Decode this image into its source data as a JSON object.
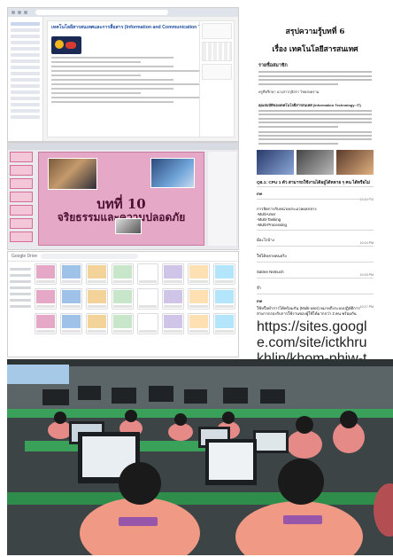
{
  "site": {
    "course_title": "เทคโนโลยีสารสนเทศและการสื่อสาร (Information and Communication Technology)"
  },
  "slides": {
    "chapter": "บทที่ 10",
    "chapter_title": "จริยธรรมและความปลอดภัย"
  },
  "drive": {
    "app_name": "Google Drive"
  },
  "doc": {
    "title": "สรุปความรู้บทที่ 6",
    "subtitle": "เรื่อง เทคโนโลยีสารสนเทศ",
    "members_heading": "รายชื่อสมาชิก",
    "advisor": "ครูที่ปรึกษา นางสาวกุลิสรา ไชยสงคราม",
    "intro_heading": "คุณสมบัติของเทคโนโลยีสารสนเทศ (Information Technology: IT)",
    "question": "Q8.1: CPU 1 ตัว สามารถใช้งานได้อยู่ได้หลาย ๆ คน ได้หรือไม่",
    "messages": [
      {
        "who": "me",
        "time": "10:14 PM",
        "body": ""
      },
      {
        "who": "",
        "time": "",
        "body": "การจัดการกับหน่วยประมวลผลกลาง\n-Multi-User\n-Multi-Tasking\n-Multi-Processing"
      },
      {
        "who": "",
        "time": "10:14 PM",
        "body": "มีอะไรบ้าง"
      },
      {
        "who": "",
        "time": "",
        "body": "ใช่ได้หลายคนจริง"
      },
      {
        "who": "",
        "time": "10:15 PM",
        "body": "Satree Netnuch"
      },
      {
        "who": "",
        "time": "",
        "body": "จ๊า"
      },
      {
        "who": "me",
        "time": "10:17 PM",
        "body": "ใช้หรือทำการได้พร้อมกัน (Multi-user) หมายถึงระบบปฏิบัติการสามารถรองรับการใช้งานของผู้ใช้ได้มากกว่า 2 คน พร้อมกัน"
      }
    ],
    "link": "https://sites.google.com/site/ictkhrukhlin/khom-phiw-texr-khux-xari/sxftwaer/khxmphiwtexrmidkhxngkhuneriyng-thaeng-haw-phu-chi-multi-user"
  },
  "colors": {
    "slide_pink": "#e6a8c7",
    "shirt_salmon": "#f09a86",
    "desk_green": "#3aa15a",
    "link_blue": "#1a4fc7"
  }
}
